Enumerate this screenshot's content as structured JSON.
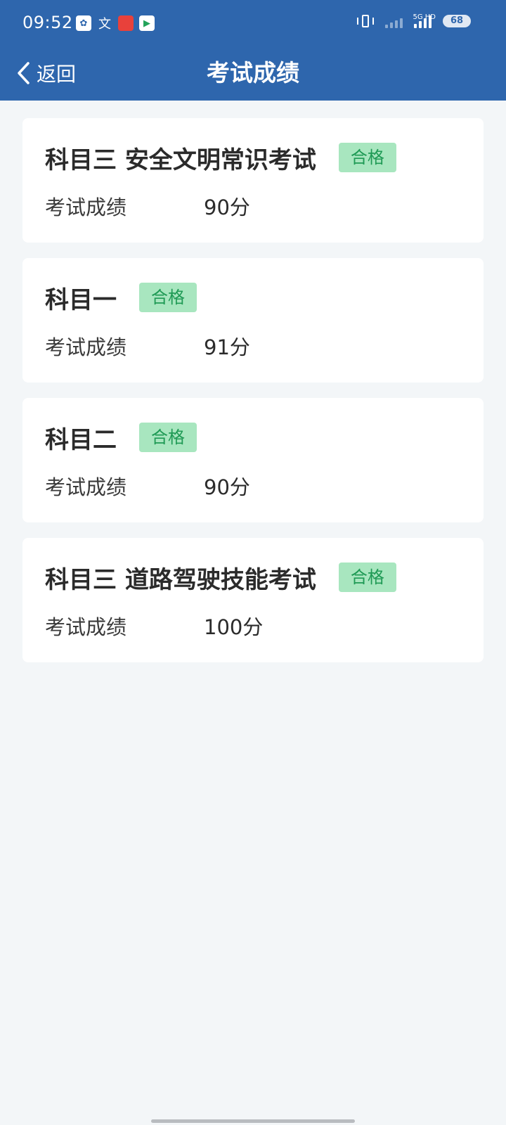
{
  "status_bar": {
    "time": "09:52",
    "notification_icons": [
      "baidu-icon",
      "translate-icon",
      "red-app-icon",
      "video-app-icon"
    ],
    "network_label": "5G HD",
    "battery": "68"
  },
  "nav": {
    "back_label": "返回",
    "title": "考试成绩"
  },
  "results": [
    {
      "subject": "科目三 安全文明常识考试",
      "status": "合格",
      "score_label": "考试成绩",
      "score": "90分"
    },
    {
      "subject": "科目一",
      "status": "合格",
      "score_label": "考试成绩",
      "score": "91分"
    },
    {
      "subject": "科目二",
      "status": "合格",
      "score_label": "考试成绩",
      "score": "90分"
    },
    {
      "subject": "科目三 道路驾驶技能考试",
      "status": "合格",
      "score_label": "考试成绩",
      "score": "100分"
    }
  ],
  "colors": {
    "header": "#2e66ad",
    "background": "#f3f6f8",
    "badge_bg": "#a8e6bf",
    "badge_text": "#1f9a55"
  }
}
